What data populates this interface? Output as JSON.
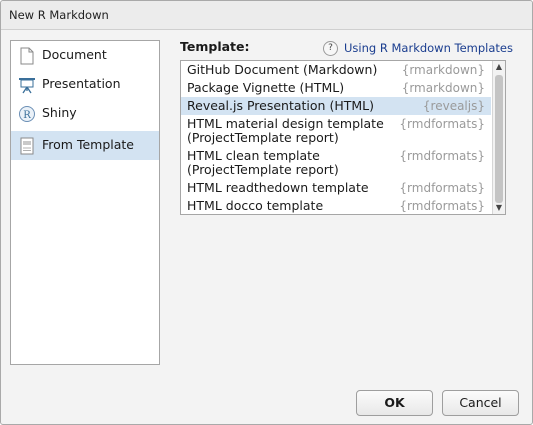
{
  "window": {
    "title": "New R Markdown"
  },
  "sidebar": {
    "items": [
      {
        "label": "Document",
        "icon": "document-icon",
        "selected": false
      },
      {
        "label": "Presentation",
        "icon": "presentation-icon",
        "selected": false
      },
      {
        "label": "Shiny",
        "icon": "shiny-icon",
        "selected": false
      },
      {
        "label": "From Template",
        "icon": "template-icon",
        "selected": true
      }
    ]
  },
  "template_panel": {
    "label": "Template:",
    "help_link": "Using R Markdown Templates",
    "help_icon": "?",
    "templates": [
      {
        "name": "GitHub Document (Markdown)",
        "package": "{rmarkdown}",
        "selected": false
      },
      {
        "name": "Package Vignette (HTML)",
        "package": "{rmarkdown}",
        "selected": false
      },
      {
        "name": "Reveal.js Presentation (HTML)",
        "package": "{revealjs}",
        "selected": true
      },
      {
        "name": "HTML material design template (ProjectTemplate report)",
        "package": "{rmdformats}",
        "selected": false
      },
      {
        "name": "HTML clean template (ProjectTemplate report)",
        "package": "{rmdformats}",
        "selected": false
      },
      {
        "name": "HTML readthedown template",
        "package": "{rmdformats}",
        "selected": false
      },
      {
        "name": "HTML docco template",
        "package": "{rmdformats}",
        "selected": false
      }
    ]
  },
  "buttons": {
    "ok": "OK",
    "cancel": "Cancel"
  },
  "colors": {
    "selection": "#d3e3f2",
    "link": "#1a3d8f",
    "package_text": "#9a9a9a"
  }
}
